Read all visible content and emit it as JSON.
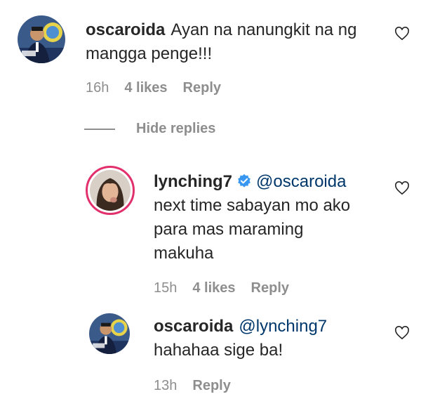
{
  "comments": [
    {
      "username": "oscaroida",
      "text": "Ayan na nanungkit na ng mangga penge!!!",
      "time": "16h",
      "likes": "4 likes",
      "reply": "Reply"
    }
  ],
  "hide_replies": "Hide replies",
  "replies": [
    {
      "username": "lynching7",
      "verified": true,
      "mention": "@oscaroida",
      "text_lines": [
        "next time sabayan mo ako",
        "para mas maraming",
        "makuha"
      ],
      "time": "15h",
      "likes": "4 likes",
      "reply": "Reply"
    },
    {
      "username": "oscaroida",
      "mention": "@lynching7",
      "text": "hahahaa sige ba!",
      "time": "13h",
      "reply": "Reply"
    }
  ],
  "icons": {
    "heart": "heart-outline-icon",
    "verified": "verified-badge-icon"
  },
  "colors": {
    "text": "#262626",
    "secondary": "#8e8e8e",
    "mention": "#00376b",
    "verified": "#3897f0"
  }
}
